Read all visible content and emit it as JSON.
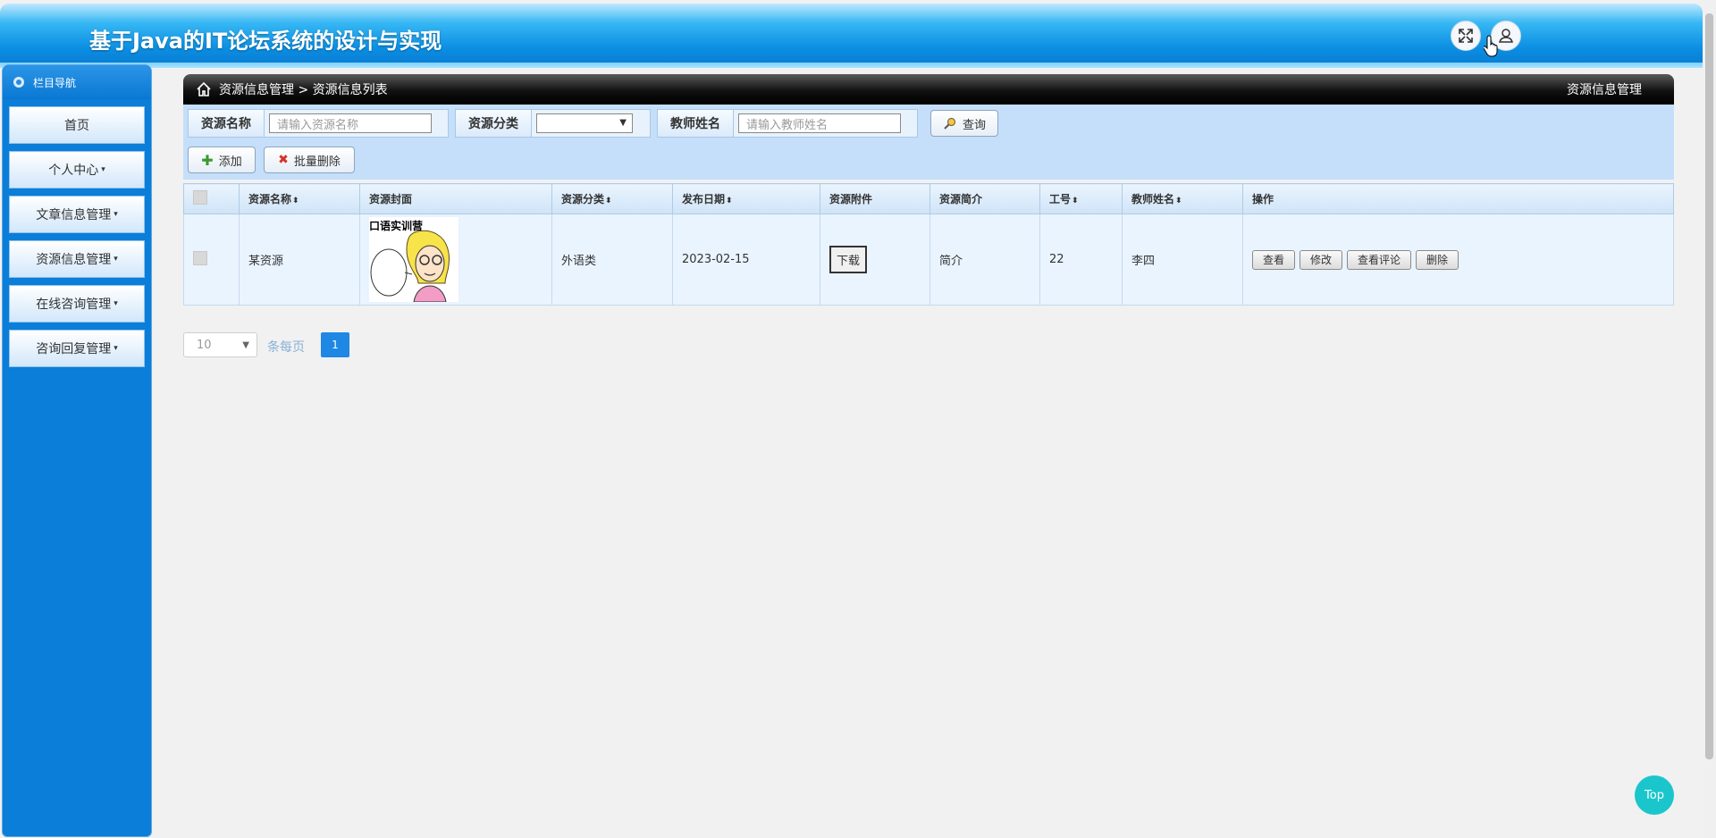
{
  "header": {
    "title": "基于Java的IT论坛系统的设计与实现",
    "fullscreen_icon": "expand-icon",
    "user_icon": "user-icon"
  },
  "sidebar": {
    "heading": "栏目导航",
    "items": [
      {
        "label": "首页",
        "has_caret": false
      },
      {
        "label": "个人中心",
        "has_caret": true
      },
      {
        "label": "文章信息管理",
        "has_caret": true
      },
      {
        "label": "资源信息管理",
        "has_caret": true
      },
      {
        "label": "在线咨询管理",
        "has_caret": true
      },
      {
        "label": "咨询回复管理",
        "has_caret": true
      }
    ],
    "caret": "▾"
  },
  "breadcrumb": {
    "path": "资源信息管理 > 资源信息列表",
    "right": "资源信息管理"
  },
  "search": {
    "name_label": "资源名称",
    "name_placeholder": "请输入资源名称",
    "category_label": "资源分类",
    "category_value": "",
    "teacher_label": "教师姓名",
    "teacher_placeholder": "请输入教师姓名",
    "query_label": "查询",
    "add_label": "添加",
    "batch_delete_label": "批量删除"
  },
  "table": {
    "headers": [
      "资源名称",
      "资源封面",
      "资源分类",
      "发布日期",
      "资源附件",
      "资源简介",
      "工号",
      "教师姓名",
      "操作"
    ],
    "sort_icon": "⬍",
    "rows": [
      {
        "name": "某资源",
        "cover_text": "口语实训营",
        "category": "外语类",
        "date": "2023-02-15",
        "attachment_button": "下载",
        "intro": "简介",
        "job_no": "22",
        "teacher": "李四",
        "actions": [
          "查看",
          "修改",
          "查看评论",
          "删除"
        ]
      }
    ]
  },
  "pagination": {
    "page_size": "10",
    "per_page_label": "条每页",
    "current_page": "1"
  },
  "top_button": "Top"
}
